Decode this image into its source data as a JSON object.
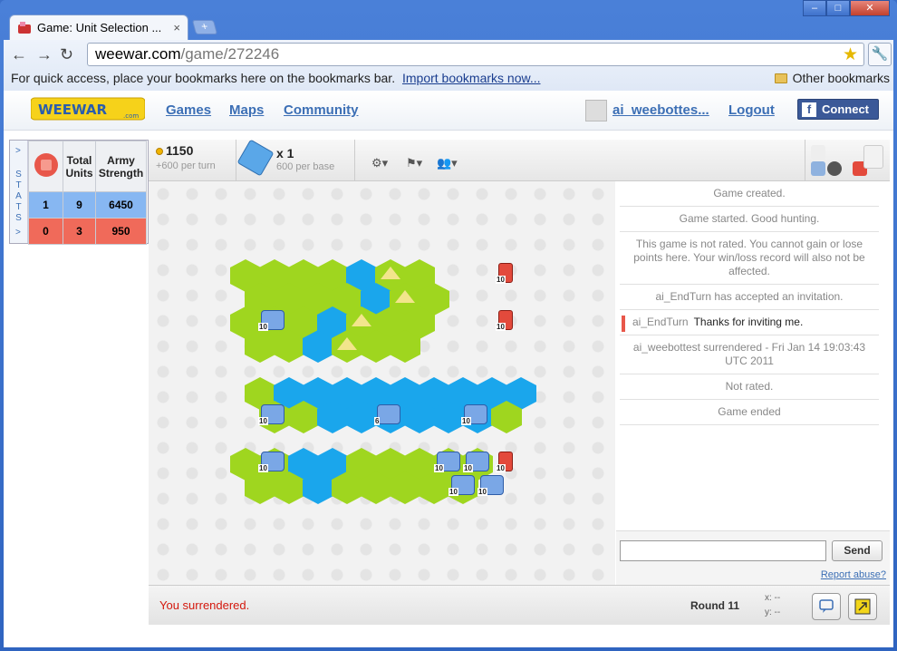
{
  "browser": {
    "tab_title": "Game: Unit Selection ...",
    "tab_close": "×",
    "new_tab": "+",
    "url_host": "weewar.com",
    "url_path": "/game/272246",
    "bookmarks_prompt": "For quick access, place your bookmarks here on the bookmarks bar.",
    "import_link": "Import bookmarks now...",
    "other_bookmarks": "Other bookmarks"
  },
  "site": {
    "logo_text": "WEEWAR",
    "logo_sub": ".com",
    "nav": [
      "Games",
      "Maps",
      "Community"
    ],
    "username": "ai_weebottes...",
    "logout": "Logout",
    "facebook_connect": "Connect"
  },
  "stats": {
    "tab_label": "STATS",
    "headers": [
      "Total Units",
      "Army Strength"
    ],
    "rows": [
      {
        "player": "1",
        "units": "9",
        "strength": "6450"
      },
      {
        "player": "0",
        "units": "3",
        "strength": "950"
      }
    ]
  },
  "gamebar": {
    "credits": "1150",
    "credits_rate": "+600 per turn",
    "bases": "x 1",
    "bases_rate": "600 per base"
  },
  "chat": {
    "messages": [
      {
        "type": "system",
        "text": "Game created."
      },
      {
        "type": "system",
        "text": "Game started. Good hunting."
      },
      {
        "type": "system",
        "text": "This game is not rated. You cannot gain or lose points here. Your win/loss record will also not be affected."
      },
      {
        "type": "system",
        "text": "ai_EndTurn has accepted an invitation."
      },
      {
        "type": "user",
        "author": "ai_EndTurn",
        "text": "Thanks for inviting me."
      },
      {
        "type": "system",
        "text": "ai_weebottest surrendered - Fri Jan 14 19:03:43 UTC 2011"
      },
      {
        "type": "system",
        "text": "Not rated."
      },
      {
        "type": "system",
        "text": "Game ended"
      }
    ],
    "send_label": "Send",
    "report_link": "Report abuse?"
  },
  "status": {
    "message": "You surrendered.",
    "round": "Round 11",
    "x_label": "x: --",
    "y_label": "y: --"
  },
  "colors": {
    "player_blue": "#87b7f2",
    "player_red": "#f06a5a",
    "grass": "#9fd61f",
    "water": "#1aa6ec"
  }
}
